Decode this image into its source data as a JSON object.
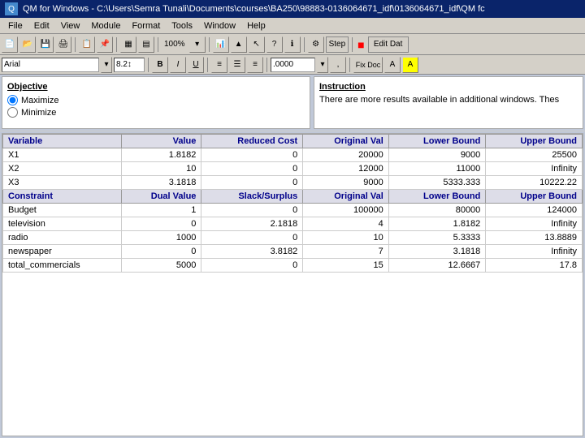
{
  "title_bar": {
    "text": "QM for Windows - C:\\Users\\Semra Tunali\\Documents\\courses\\BA250\\98883-0136064671_idf\\0136064671_idf\\QM fc"
  },
  "menu": {
    "items": [
      "File",
      "Edit",
      "View",
      "Module",
      "Format",
      "Tools",
      "Window",
      "Help"
    ]
  },
  "toolbar1": {
    "zoom": "100%",
    "step_btn": "Step",
    "edit_dat_btn": "Edit Dat"
  },
  "format_bar": {
    "font": "Arial",
    "size": "8.2↕",
    "bold": "B",
    "italic": "I",
    "underline": "U",
    "number": ".0000",
    "doc_btn": "Fix Doc"
  },
  "objective": {
    "title": "Objective",
    "maximize_label": "Maximize",
    "minimize_label": "Minimize"
  },
  "instruction": {
    "title": "Instruction",
    "text": "There are more results available in additional windows. Thes"
  },
  "variables_table": {
    "headers": [
      "Variable",
      "Value",
      "Reduced Cost",
      "Original Val",
      "Lower Bound",
      "Upper Bound"
    ],
    "rows": [
      [
        "X1",
        "1.8182",
        "0",
        "20000",
        "9000",
        "25500"
      ],
      [
        "X2",
        "10",
        "0",
        "12000",
        "11000",
        "Infinity"
      ],
      [
        "X3",
        "3.1818",
        "0",
        "9000",
        "5333.333",
        "10222.22"
      ]
    ]
  },
  "constraints_table": {
    "headers": [
      "Constraint",
      "Dual Value",
      "Slack/Surplus",
      "Original Val",
      "Lower Bound",
      "Upper Bound"
    ],
    "rows": [
      [
        "Budget",
        "1",
        "0",
        "100000",
        "80000",
        "124000"
      ],
      [
        "television",
        "0",
        "2.1818",
        "4",
        "1.8182",
        "Infinity"
      ],
      [
        "radio",
        "1000",
        "0",
        "10",
        "5.3333",
        "13.8889"
      ],
      [
        "newspaper",
        "0",
        "3.8182",
        "7",
        "3.1818",
        "Infinity"
      ],
      [
        "total_commercials",
        "5000",
        "0",
        "15",
        "12.6667",
        "17.8"
      ]
    ]
  }
}
